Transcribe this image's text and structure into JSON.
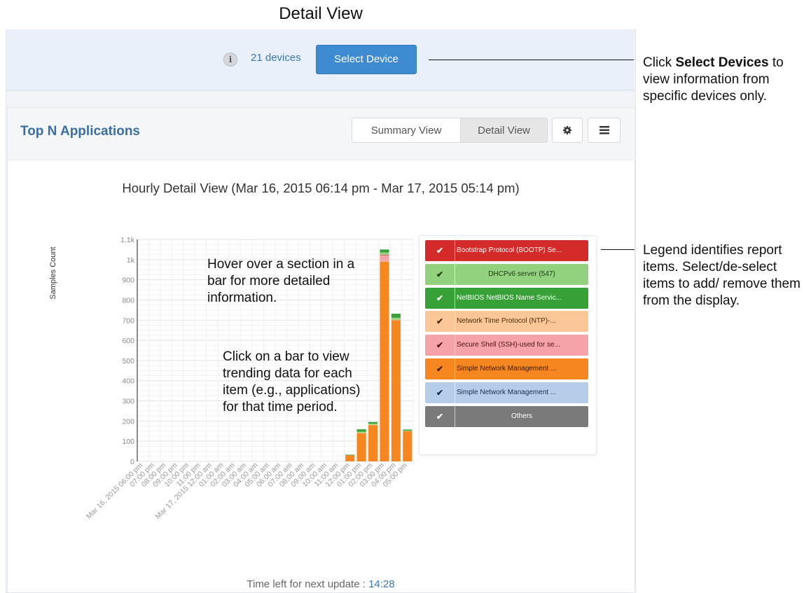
{
  "page_title": "Detail View",
  "device_bar": {
    "info_icon": "i",
    "devices_count_label": "21 devices",
    "select_device_label": "Select Device"
  },
  "widget": {
    "title": "Top N Applications",
    "summary_view_label": "Summary View",
    "detail_view_label": "Detail View",
    "settings_icon": "gear-icon",
    "menu_icon": "list-menu-icon"
  },
  "chart_data": {
    "type": "bar",
    "stacked": true,
    "title": "Hourly Detail View (Mar 16, 2015 06:14 pm - Mar 17, 2015 05:14 pm)",
    "ylabel": "Samples Count",
    "xlabel": "",
    "ylim": [
      0,
      1100
    ],
    "y_ticks": [
      "0",
      "100",
      "200",
      "300",
      "400",
      "500",
      "600",
      "700",
      "800",
      "900",
      "1k",
      "1.1k"
    ],
    "grid": true,
    "legend_position": "right",
    "categories": [
      "Mar 16, 2015 06:00 pm",
      "07:00 pm",
      "08:00 pm",
      "09:00 pm",
      "10:00 pm",
      "11:00 pm",
      "Mar 17, 2015 12:00 am",
      "01:00 am",
      "02:00 am",
      "03:00 am",
      "04:00 am",
      "05:00 am",
      "06:00 am",
      "07:00 am",
      "08:00 am",
      "09:00 am",
      "10:00 am",
      "11:00 am",
      "12:00 pm",
      "01:00 pm",
      "02:00 pm",
      "03:00 pm",
      "04:00 pm",
      "05:00 pm"
    ],
    "series": [
      {
        "name": "Bootstrap Protocol (BOOTP) Se...",
        "color": "#d42a2a",
        "values": [
          0,
          0,
          0,
          0,
          0,
          0,
          0,
          0,
          0,
          0,
          0,
          0,
          0,
          0,
          0,
          0,
          0,
          0,
          0,
          0,
          0,
          2,
          0,
          0
        ]
      },
      {
        "name": "DHCPv6 server (547)",
        "color": "#92d27f",
        "values": [
          0,
          0,
          0,
          0,
          0,
          0,
          0,
          0,
          0,
          0,
          0,
          0,
          0,
          0,
          0,
          0,
          0,
          0,
          0,
          5,
          5,
          12,
          10,
          3
        ]
      },
      {
        "name": "NetBIOS NetBIOS Name Servic...",
        "color": "#37a137",
        "values": [
          0,
          0,
          0,
          0,
          0,
          0,
          0,
          0,
          0,
          0,
          0,
          0,
          0,
          0,
          0,
          0,
          0,
          0,
          3,
          12,
          8,
          14,
          20,
          5
        ]
      },
      {
        "name": "Network Time Protocol (NTP)-...",
        "color": "#fbc797",
        "values": [
          0,
          0,
          0,
          0,
          0,
          0,
          0,
          0,
          0,
          0,
          0,
          0,
          0,
          0,
          0,
          0,
          0,
          0,
          0,
          2,
          2,
          2,
          2,
          0
        ]
      },
      {
        "name": "Secure Shell (SSH)-used for se...",
        "color": "#f5a3a9",
        "values": [
          0,
          0,
          0,
          0,
          0,
          0,
          0,
          0,
          0,
          0,
          0,
          0,
          0,
          0,
          0,
          0,
          0,
          0,
          0,
          0,
          0,
          30,
          0,
          0
        ]
      },
      {
        "name": "Simple Network Management ...",
        "color": "#f6861f",
        "values": [
          0,
          0,
          0,
          0,
          0,
          0,
          0,
          0,
          0,
          0,
          0,
          0,
          0,
          0,
          0,
          0,
          0,
          0,
          30,
          140,
          180,
          990,
          700,
          150
        ]
      },
      {
        "name": "Simple Network Management ...",
        "color": "#b5cde9",
        "values": [
          0,
          0,
          0,
          0,
          0,
          0,
          0,
          0,
          0,
          0,
          0,
          0,
          0,
          0,
          0,
          0,
          0,
          0,
          0,
          0,
          0,
          0,
          0,
          0
        ]
      },
      {
        "name": "Others",
        "color": "#7a7a7a",
        "values": [
          0,
          0,
          0,
          0,
          0,
          0,
          0,
          0,
          0,
          0,
          0,
          0,
          0,
          0,
          0,
          0,
          0,
          0,
          0,
          0,
          0,
          0,
          0,
          0
        ]
      }
    ]
  },
  "legend": [
    {
      "label": "Bootstrap Protocol (BOOTP) Se...",
      "color": "#d42a2a",
      "text_color": "#ffffff",
      "checked": true
    },
    {
      "label": "DHCPv6 server (547)",
      "color": "#92d27f",
      "text_color": "#1d3a12",
      "checked": true
    },
    {
      "label": "NetBIOS NetBIOS Name Servic...",
      "color": "#37a137",
      "text_color": "#ffffff",
      "checked": true
    },
    {
      "label": "Network Time Protocol (NTP)-...",
      "color": "#fbc797",
      "text_color": "#4a2a0a",
      "checked": true
    },
    {
      "label": "Secure Shell (SSH)-used for se...",
      "color": "#f5a3a9",
      "text_color": "#4a1418",
      "checked": true
    },
    {
      "label": "Simple Network Management ...",
      "color": "#f6861f",
      "text_color": "#3a1c02",
      "checked": true
    },
    {
      "label": "Simple Network Management ...",
      "color": "#b5cde9",
      "text_color": "#17304f",
      "checked": true
    },
    {
      "label": "Others",
      "color": "#7a7a7a",
      "text_color": "#ffffff",
      "checked": true
    }
  ],
  "annotations": {
    "hover_note": "Hover over a section in a bar for more detailed information.",
    "click_note": "Click on a bar to view trending data for each item (e.g., applications) for that time period.",
    "select_devices_prefix": "Click ",
    "select_devices_bold": "Select Devices",
    "select_devices_suffix": " to view information from specific devices only.",
    "legend_callout": "Legend identifies report items. Select/de-select items to add/ remove them from the display."
  },
  "footer": {
    "label": "Time left for next update : ",
    "timer": "14:28"
  }
}
